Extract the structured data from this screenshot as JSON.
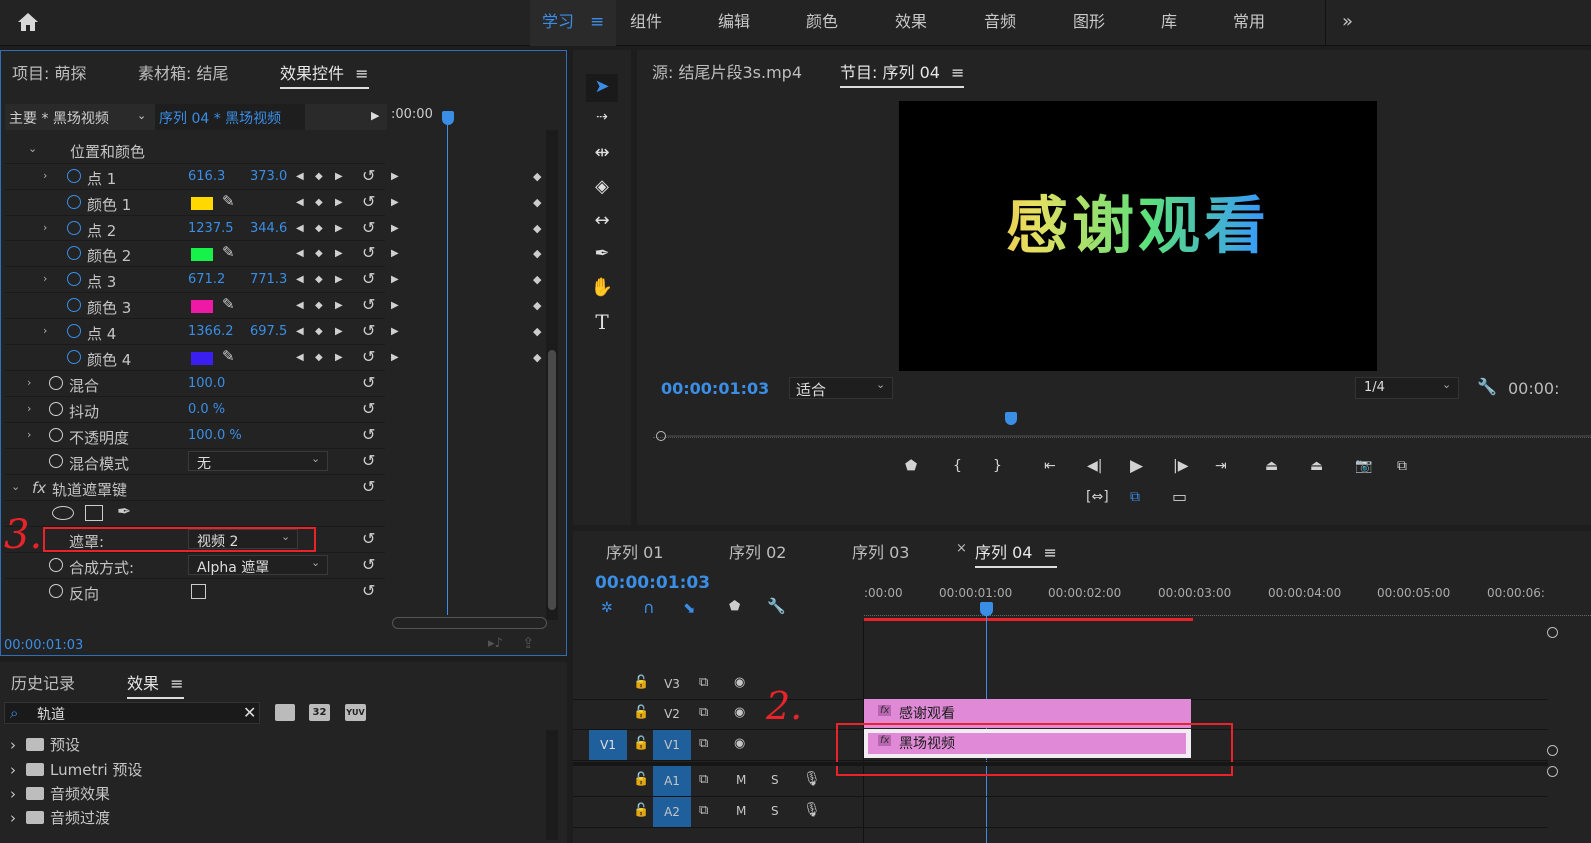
{
  "workspaces": [
    "学习",
    "组件",
    "编辑",
    "颜色",
    "效果",
    "音频",
    "图形",
    "库",
    "常用"
  ],
  "left_panel": {
    "tabs": [
      "项目: 萌探",
      "素材箱: 结尾",
      "效果控件"
    ],
    "master_label": "主要 * 黑场视频",
    "sequence_label": "序列 04 * 黑场视频",
    "timecode_head": ":00:00",
    "section_title": "位置和颜色",
    "rows": [
      {
        "label": "点 1",
        "v1": "616.3",
        "v2": "373.0"
      },
      {
        "label": "颜色 1",
        "color": "#ffd800"
      },
      {
        "label": "点 2",
        "v1": "1237.5",
        "v2": "344.6"
      },
      {
        "label": "颜色 2",
        "color": "#16f24a"
      },
      {
        "label": "点 3",
        "v1": "671.2",
        "v2": "771.3"
      },
      {
        "label": "颜色 3",
        "color": "#ee1aa6"
      },
      {
        "label": "点 4",
        "v1": "1366.2",
        "v2": "697.5"
      },
      {
        "label": "颜色 4",
        "color": "#3b1ef0"
      }
    ],
    "blend": {
      "label": "混合",
      "value": "100.0"
    },
    "jitter": {
      "label": "抖动",
      "value": "0.0 %"
    },
    "opacity": {
      "label": "不透明度",
      "value": "100.0 %"
    },
    "blend_mode": {
      "label": "混合模式",
      "value": "无"
    },
    "track_matte": {
      "label": "轨道遮罩键"
    },
    "matte": {
      "label": "遮罩:",
      "value": "视频 2"
    },
    "composite": {
      "label": "合成方式:",
      "value": "Alpha 遮罩"
    },
    "reverse": {
      "label": "反向"
    },
    "footer_time": "00:00:01:03"
  },
  "effects_panel": {
    "tabs": [
      "历史记录",
      "效果"
    ],
    "search_value": "轨道",
    "items": [
      "预设",
      "Lumetri 预设",
      "音频效果",
      "音频过渡"
    ]
  },
  "program": {
    "tabs": [
      "源: 结尾片段3s.mp4",
      "节目: 序列 04"
    ],
    "video_text": "感谢观看",
    "timecode": "00:00:01:03",
    "fit": "适合",
    "resolution": "1/4",
    "duration": "00:00:"
  },
  "timeline": {
    "tabs": [
      "序列 01",
      "序列 02",
      "序列 03",
      "序列 04"
    ],
    "timecode": "00:00:01:03",
    "ruler": [
      ":00:00",
      "00:00:01:00",
      "00:00:02:00",
      "00:00:03:00",
      "00:00:04:00",
      "00:00:05:00",
      "00:00:06:"
    ],
    "tracks": [
      "V3",
      "V2",
      "V1",
      "A1",
      "A2"
    ],
    "source_patch": "V1",
    "clips": [
      "感谢观看",
      "黑场视频"
    ],
    "fx": "fx",
    "m": "M",
    "s": "S"
  },
  "annotations": [
    "3.",
    "2."
  ]
}
